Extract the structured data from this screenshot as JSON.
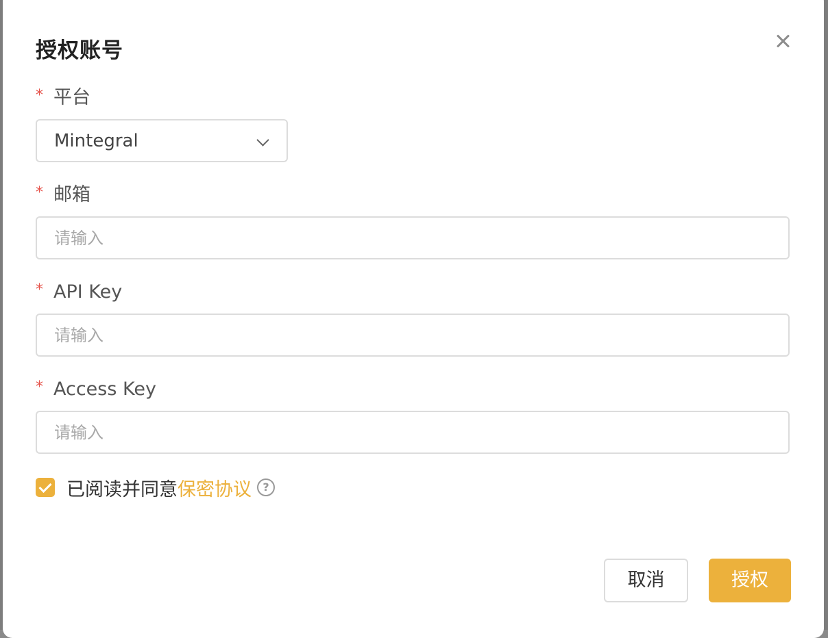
{
  "modal": {
    "title": "授权账号",
    "close_icon": "close-icon"
  },
  "form": {
    "required_mark": "*",
    "platform": {
      "label": "平台",
      "selected": "Mintegral"
    },
    "email": {
      "label": "邮箱",
      "placeholder": "请输入",
      "value": ""
    },
    "api_key": {
      "label": "API Key",
      "placeholder": "请输入",
      "value": ""
    },
    "access_key": {
      "label": "Access Key",
      "placeholder": "请输入",
      "value": ""
    },
    "agreement": {
      "checked": true,
      "text": "已阅读并同意",
      "link": "保密协议",
      "help_icon": "question-circle-icon"
    }
  },
  "footer": {
    "cancel_label": "取消",
    "ok_label": "授权"
  },
  "colors": {
    "accent": "#ecb13c",
    "required": "#e5534b",
    "border": "#dcdcdc"
  }
}
